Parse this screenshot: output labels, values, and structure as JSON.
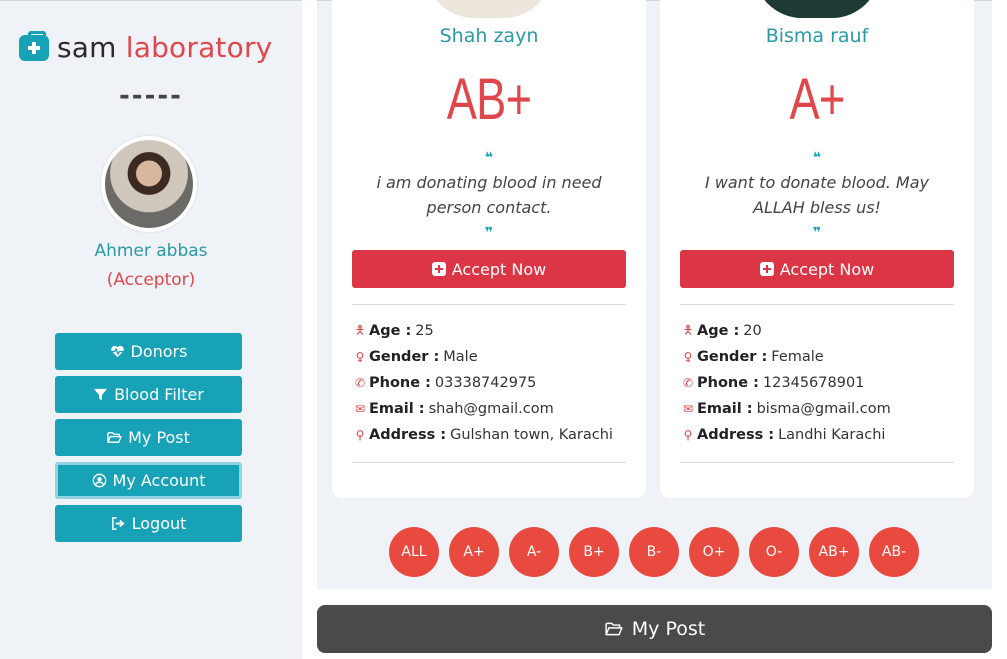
{
  "brand": {
    "name_part1": "sam",
    "name_part2": " laboratory",
    "icon": "medkit-icon"
  },
  "sidebar": {
    "divider": "-----",
    "user": {
      "name": "Ahmer abbas",
      "role": "(Acceptor)"
    },
    "menu": [
      {
        "label": "Donors",
        "icon": "heartbeat-icon"
      },
      {
        "label": "Blood Filter",
        "icon": "filter-icon"
      },
      {
        "label": "My Post",
        "icon": "folder-open-icon"
      },
      {
        "label": "My Account",
        "icon": "user-circle-icon",
        "active": true
      },
      {
        "label": "Logout",
        "icon": "sign-out-icon"
      }
    ]
  },
  "cards": [
    {
      "name": "Shah zayn",
      "blood_group": "AB+",
      "quote_open": "❝",
      "message": "i am donating blood in need person contact.",
      "quote_close": "❞",
      "accept_label": "Accept Now",
      "details": {
        "age_label": "Age :",
        "age": "25",
        "gender_label": "Gender :",
        "gender": "Male",
        "phone_label": "Phone :",
        "phone": "03338742975",
        "email_label": "Email :",
        "email": "shah@gmail.com",
        "address_label": "Address :",
        "address": "Gulshan town, Karachi"
      }
    },
    {
      "name": "Bisma rauf",
      "blood_group": "A+",
      "quote_open": "❝",
      "message": "I want to donate blood. May ALLAH bless us!",
      "quote_close": "❞",
      "accept_label": "Accept Now",
      "details": {
        "age_label": "Age :",
        "age": "20",
        "gender_label": "Gender :",
        "gender": "Female",
        "phone_label": "Phone :",
        "phone": "12345678901",
        "email_label": "Email :",
        "email": "bisma@gmail.com",
        "address_label": "Address :",
        "address": "Landhi Karachi"
      }
    }
  ],
  "filters": [
    "ALL",
    "A+",
    "A-",
    "B+",
    "B-",
    "O+",
    "O-",
    "AB+",
    "AB-"
  ],
  "bottom_bar": {
    "label": "My Post",
    "icon": "folder-open-icon"
  },
  "colors": {
    "teal": "#17a2b8",
    "red": "#dc3545",
    "coral": "#e84a3f",
    "dark": "#4a4a4a",
    "panel": "#eff3f7"
  }
}
